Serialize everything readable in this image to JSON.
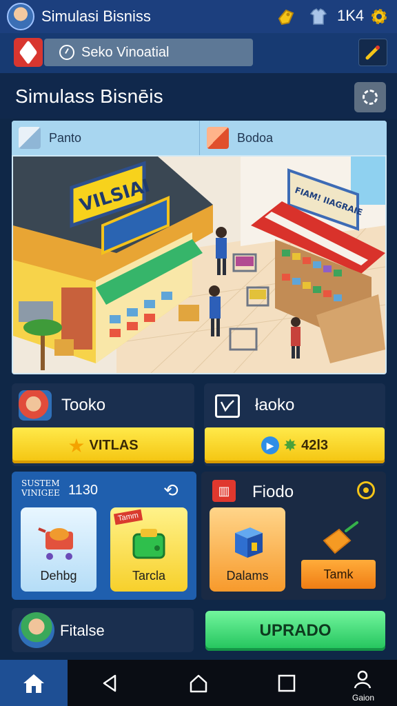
{
  "app": {
    "title": "Simulasi Bisniss",
    "counter": "1K4"
  },
  "status": {
    "text": "Seko Vinoatial"
  },
  "page": {
    "title": "Simulass Bisnēis"
  },
  "scene": {
    "tabs": [
      {
        "label": "Panto"
      },
      {
        "label": "Bodoa"
      }
    ],
    "sign_left": "VILSIAI",
    "sign_right": "FIAM! IIAGRAIE"
  },
  "cards": {
    "toko_left": {
      "title": "Tooko",
      "button": "VITLAS"
    },
    "toko_right": {
      "title": "łaoko",
      "button_value": "42l3"
    },
    "system": {
      "label_line1": "SUSTEM",
      "label_line2": "VINIGEE",
      "value": "1130",
      "tiles": [
        {
          "label": "Dehbg"
        },
        {
          "label": "Tarcla",
          "tag": "Tamm"
        }
      ]
    },
    "fiodo": {
      "title": "Fiodo",
      "tiles": [
        {
          "label": "Dalams"
        },
        {
          "label": "Tamk"
        }
      ]
    },
    "fitasse": {
      "title": "Fitalse"
    },
    "upgrade": {
      "label": "UPRADO"
    }
  },
  "nav": {
    "last_label": "Gaion"
  },
  "colors": {
    "topbar": "#1c3f7e",
    "yellow": "#f4c40f",
    "green": "#21c35b",
    "accent_red": "#d8362f"
  }
}
